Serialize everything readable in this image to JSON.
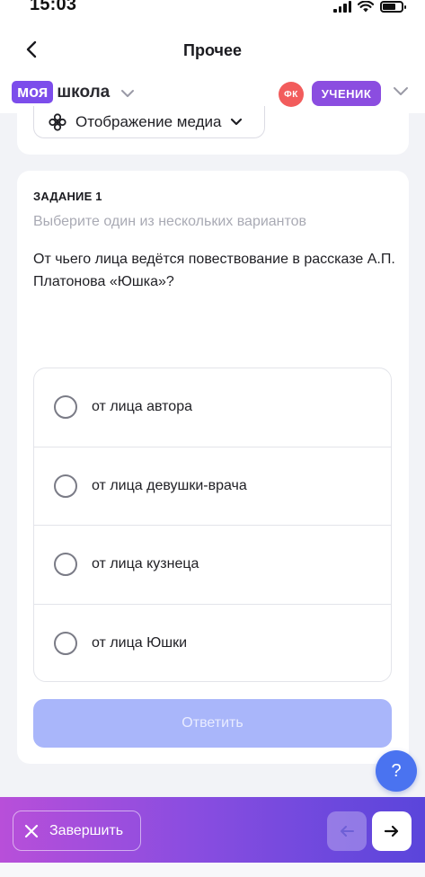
{
  "status_bar": {
    "time": "15:03"
  },
  "header": {
    "title": "Прочее"
  },
  "brand": {
    "logo_part1": "моя",
    "logo_part2": "школа",
    "avatar_initials": "ФК",
    "role": "УЧЕНИК"
  },
  "media": {
    "label": "Отображение медиа"
  },
  "task": {
    "heading": "ЗАДАНИЕ 1",
    "hint": "Выберите один из нескольких вариантов",
    "question": "От чьего лица ведётся повествование в рассказе А.П. Платонова «Юшка»?",
    "options": [
      {
        "label": "от лица автора"
      },
      {
        "label": "от лица девушки-врача"
      },
      {
        "label": "от лица кузнеца"
      },
      {
        "label": "от лица Юшки"
      }
    ],
    "answer_label": "Ответить"
  },
  "help": {
    "label": "?"
  },
  "bottom": {
    "finish_label": "Завершить"
  },
  "colors": {
    "brand": "#7C4DEB",
    "role_badge": "#8B4DE0",
    "avatar": "#F25C5C",
    "answer_disabled": "#A9B6FA",
    "help": "#4A73F0"
  }
}
